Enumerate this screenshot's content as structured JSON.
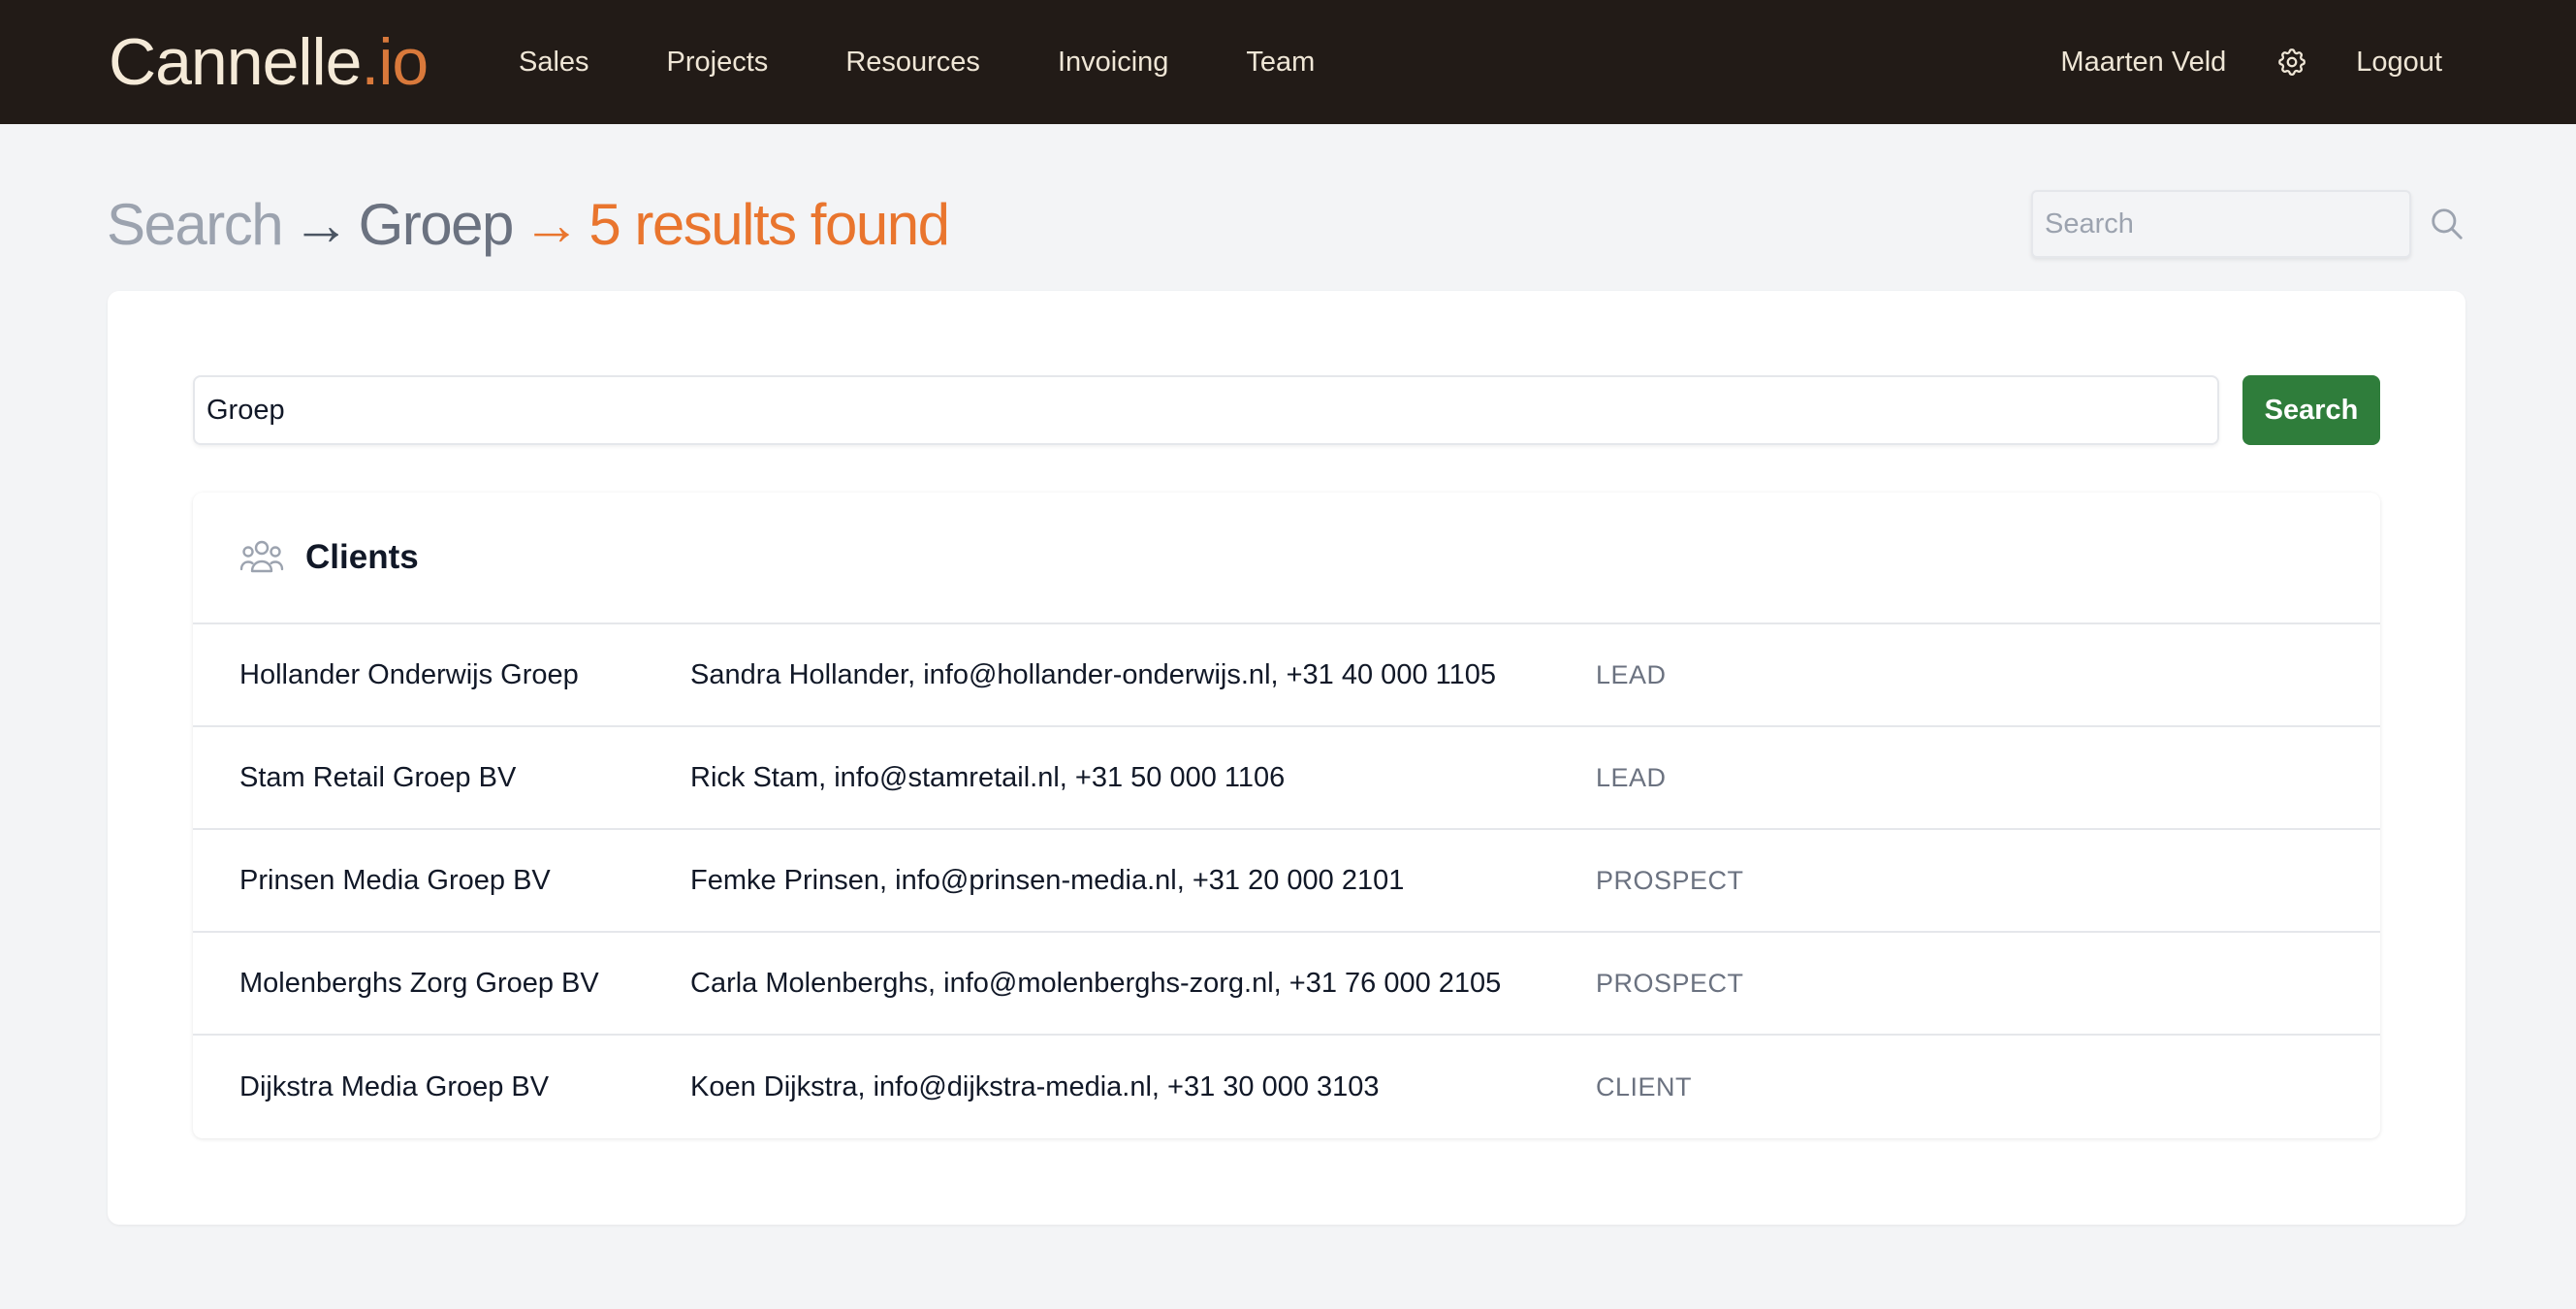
{
  "brand": {
    "name": "Cannelle",
    "suffix": ".io"
  },
  "nav": {
    "items": [
      {
        "label": "Sales"
      },
      {
        "label": "Projects"
      },
      {
        "label": "Resources"
      },
      {
        "label": "Invoicing"
      },
      {
        "label": "Team"
      }
    ]
  },
  "user": {
    "name": "Maarten Veld",
    "settings_icon": "gear-icon",
    "logout_label": "Logout"
  },
  "header": {
    "crumb_search": "Search",
    "arrow": "→",
    "search_term": "Groep",
    "results_text": "5 results found"
  },
  "top_search": {
    "placeholder": "Search",
    "icon": "search-icon"
  },
  "query": {
    "value": "Groep",
    "button_label": "Search"
  },
  "results": {
    "section_title": "Clients",
    "section_icon": "users-icon",
    "rows": [
      {
        "name": "Hollander Onderwijs Groep",
        "contact": "Sandra Hollander, info@hollander-onderwijs.nl, +31 40 000 1105",
        "status": "LEAD"
      },
      {
        "name": "Stam Retail Groep BV",
        "contact": "Rick Stam, info@stamretail.nl, +31 50 000 1106",
        "status": "LEAD"
      },
      {
        "name": "Prinsen Media Groep BV",
        "contact": "Femke Prinsen, info@prinsen-media.nl, +31 20 000 2101",
        "status": "PROSPECT"
      },
      {
        "name": "Molenberghs Zorg Groep BV",
        "contact": "Carla Molenberghs, info@molenberghs-zorg.nl, +31 76 000 2105",
        "status": "PROSPECT"
      },
      {
        "name": "Dijkstra Media Groep BV",
        "contact": "Koen Dijkstra, info@dijkstra-media.nl, +31 30 000 3103",
        "status": "CLIENT"
      }
    ]
  },
  "colors": {
    "topbar": "#221b17",
    "brand_accent": "#d9793b",
    "results_accent": "#e9752e",
    "primary_button": "#2f7d3b"
  }
}
